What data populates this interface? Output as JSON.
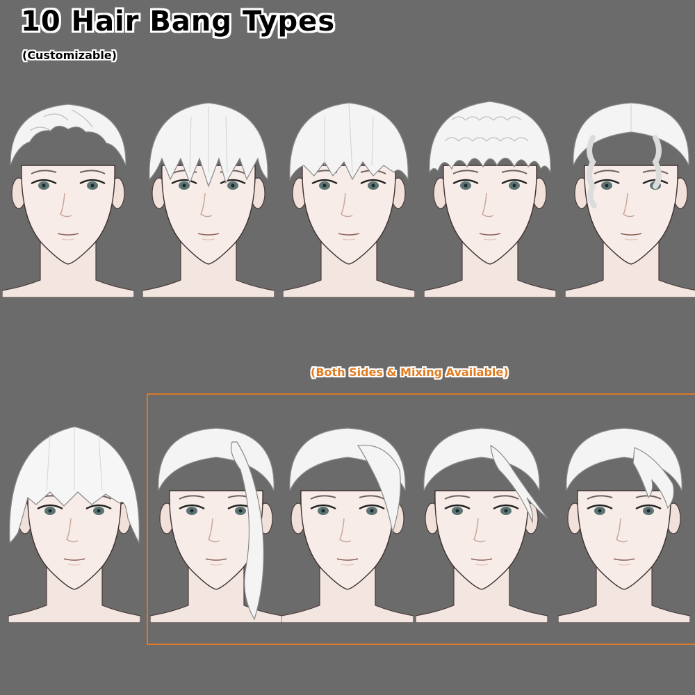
{
  "title": "10 Hair Bang Types",
  "subtitle": "(Customizable)",
  "note": "(Both Sides & Mixing Available)",
  "colors": {
    "background": "#6b6b6b",
    "accent_orange": "#d97a2b",
    "hair": "#f4f4f4",
    "skin": "#f6ebe6"
  },
  "row1_styles": [
    {
      "icon": "messy-short-bangs-icon"
    },
    {
      "icon": "straight-long-bangs-icon"
    },
    {
      "icon": "straight-fringe-bangs-icon"
    },
    {
      "icon": "curly-bangs-icon"
    },
    {
      "icon": "slicked-side-curl-bangs-icon"
    }
  ],
  "row2_styles": [
    {
      "icon": "bowl-cut-bangs-icon"
    },
    {
      "icon": "long-side-strand-bangs-icon"
    },
    {
      "icon": "swept-side-bangs-icon"
    },
    {
      "icon": "flicked-side-bangs-icon"
    },
    {
      "icon": "short-side-swept-bangs-icon"
    }
  ]
}
